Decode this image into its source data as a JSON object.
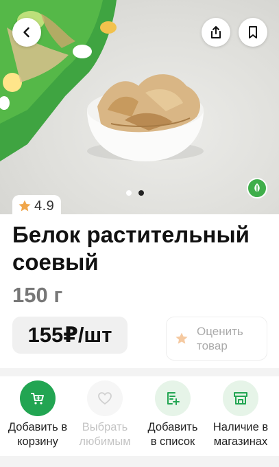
{
  "hero": {
    "slide_count": 2,
    "active_slide": 2
  },
  "rating": {
    "value": "4.9"
  },
  "product": {
    "title": "Белок растительный соевый",
    "weight": "150 г",
    "price": "155₽/шт"
  },
  "rate_product": {
    "label": "Оценить\nтовар"
  },
  "actions": [
    {
      "label": "Добавить в\nкорзину",
      "icon": "cart-icon",
      "enabled": true
    },
    {
      "label": "Выбрать\nлюбимым",
      "icon": "heart-icon",
      "enabled": false
    },
    {
      "label": "Добавить\nв список",
      "icon": "list-add-icon",
      "enabled": true
    },
    {
      "label": "Наличие в\nмагазинах",
      "icon": "store-icon",
      "enabled": true
    }
  ],
  "colors": {
    "brand_green": "#22a552",
    "star": "#f0a64a",
    "muted": "#c4c4c4"
  }
}
